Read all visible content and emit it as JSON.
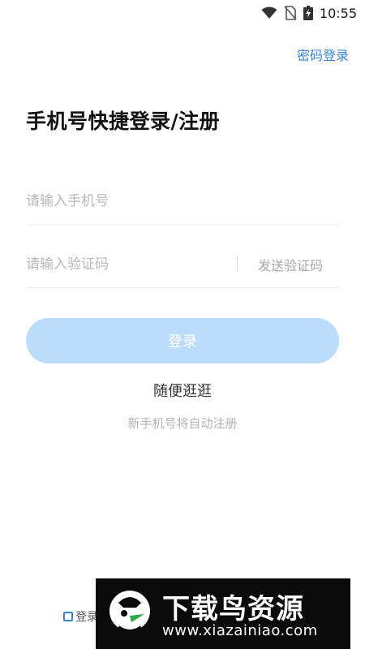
{
  "status_bar": {
    "time": "10:55",
    "icons": [
      "wifi-icon",
      "no-sim-icon",
      "battery-charging-icon"
    ]
  },
  "header": {
    "password_login_label": "密码登录"
  },
  "main": {
    "title": "手机号快捷登录/注册",
    "phone_placeholder": "请输入手机号",
    "code_placeholder": "请输入验证码",
    "send_code_label": "发送验证码",
    "login_button_label": "登录",
    "browse_label": "随便逛逛",
    "auto_register_note": "新手机号将自动注册"
  },
  "footer": {
    "agreement_text": "登录"
  },
  "watermark": {
    "title": "下载鸟资源",
    "url": "www.xiazainiao.com"
  },
  "colors": {
    "accent": "#3a86d6",
    "button_disabled_bg": "#bcdcfb",
    "placeholder": "#b8b8b8"
  }
}
